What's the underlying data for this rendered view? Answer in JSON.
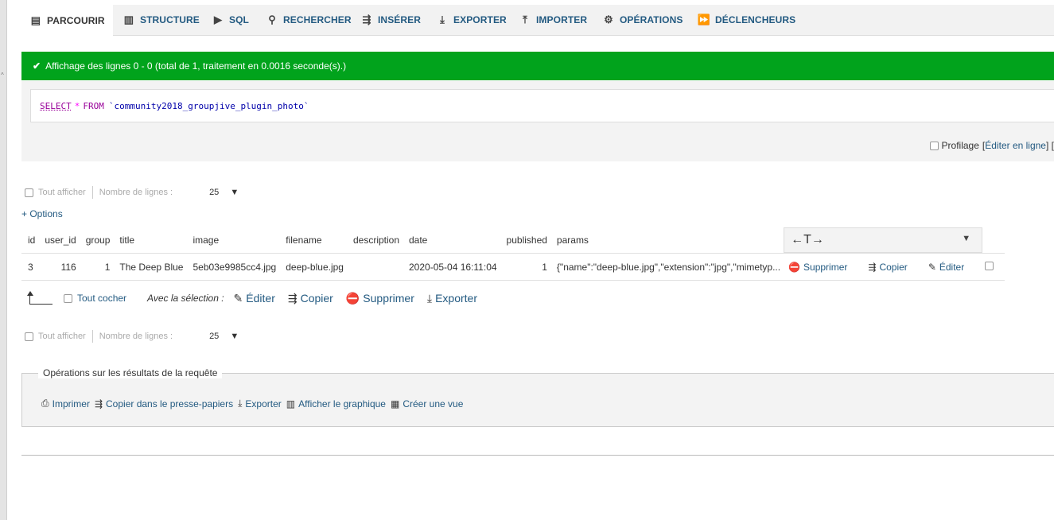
{
  "tabs": [
    {
      "label": "Parcourir",
      "icon": "table-icon"
    },
    {
      "label": "Structure",
      "icon": "structure-icon"
    },
    {
      "label": "SQL",
      "icon": "sql-icon"
    },
    {
      "label": "Rechercher",
      "icon": "search-icon"
    },
    {
      "label": "Insérer",
      "icon": "insert-icon"
    },
    {
      "label": "Exporter",
      "icon": "export-icon"
    },
    {
      "label": "Importer",
      "icon": "import-icon"
    },
    {
      "label": "Opérations",
      "icon": "gear-icon"
    },
    {
      "label": "Déclencheurs",
      "icon": "trigger-icon"
    }
  ],
  "success_message": "Affichage des lignes 0 - 0 (total de 1, traitement en 0.0016 seconde(s).)",
  "sql": {
    "select": "SELECT",
    "star": "*",
    "from": "FROM",
    "table": "`community2018_groupjive_plugin_photo`"
  },
  "profiling": {
    "label": "Profilage",
    "open": "[",
    "edit_inline": "Éditer en ligne",
    "close": "] ["
  },
  "nav": {
    "show_all": "Tout afficher",
    "rows_label": "Nombre de lignes :",
    "rows_value": "25"
  },
  "options_link": "+ Options",
  "columns": [
    "id",
    "user_id",
    "group",
    "title",
    "image",
    "filename",
    "description",
    "date",
    "published",
    "params"
  ],
  "colmenu_symbol": "←T→",
  "rows": [
    {
      "id": "3",
      "user_id": "116",
      "group": "1",
      "title": "The Deep Blue",
      "image": "5eb03e9985cc4.jpg",
      "filename": "deep-blue.jpg",
      "description": "",
      "date": "2020-05-04 16:11:04",
      "published": "1",
      "params": "{\"name\":\"deep-blue.jpg\",\"extension\":\"jpg\",\"mimetyp..."
    }
  ],
  "row_actions": {
    "delete": "Supprimer",
    "copy": "Copier",
    "edit": "Éditer"
  },
  "selection": {
    "check_all": "Tout cocher",
    "with_selection": "Avec la sélection :",
    "edit": "Éditer",
    "copy": "Copier",
    "delete": "Supprimer",
    "export": "Exporter"
  },
  "ops": {
    "legend": "Opérations sur les résultats de la requête",
    "print": "Imprimer",
    "copy_clipboard": "Copier dans le presse-papiers",
    "export": "Exporter",
    "chart": "Afficher le graphique",
    "create_view": "Créer une vue"
  }
}
